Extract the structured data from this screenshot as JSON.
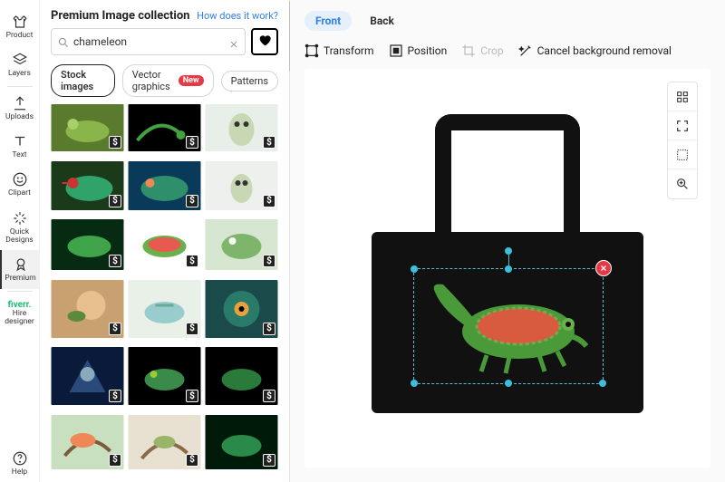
{
  "sidebar": {
    "items": [
      {
        "label": "Product",
        "icon": "tshirt"
      },
      {
        "label": "Layers",
        "icon": "layers"
      },
      {
        "label": "Uploads",
        "icon": "upload"
      },
      {
        "label": "Text",
        "icon": "text"
      },
      {
        "label": "Clipart",
        "icon": "smile"
      },
      {
        "label": "Quick Designs",
        "icon": "sparkle"
      },
      {
        "label": "Premium",
        "icon": "premium"
      }
    ],
    "fiverr": {
      "brand": "fiverr.",
      "line1": "Hire",
      "line2": "designer"
    },
    "help": {
      "label": "Help"
    }
  },
  "panel": {
    "title": "Premium Image collection",
    "how_link": "How does it work?",
    "search": {
      "value": "chameleon",
      "placeholder": "Search"
    },
    "tabs": [
      {
        "label": "Stock images",
        "active": true
      },
      {
        "label": "Vector graphics",
        "badge": "New"
      },
      {
        "label": "Patterns"
      }
    ],
    "price_symbol": "$",
    "thumbs": 18
  },
  "canvas": {
    "tabs": {
      "front": "Front",
      "back": "Back",
      "active": "Front"
    },
    "toolbar": {
      "transform": "Transform",
      "position": "Position",
      "crop": "Crop",
      "bg_removal": "Cancel background removal"
    }
  }
}
